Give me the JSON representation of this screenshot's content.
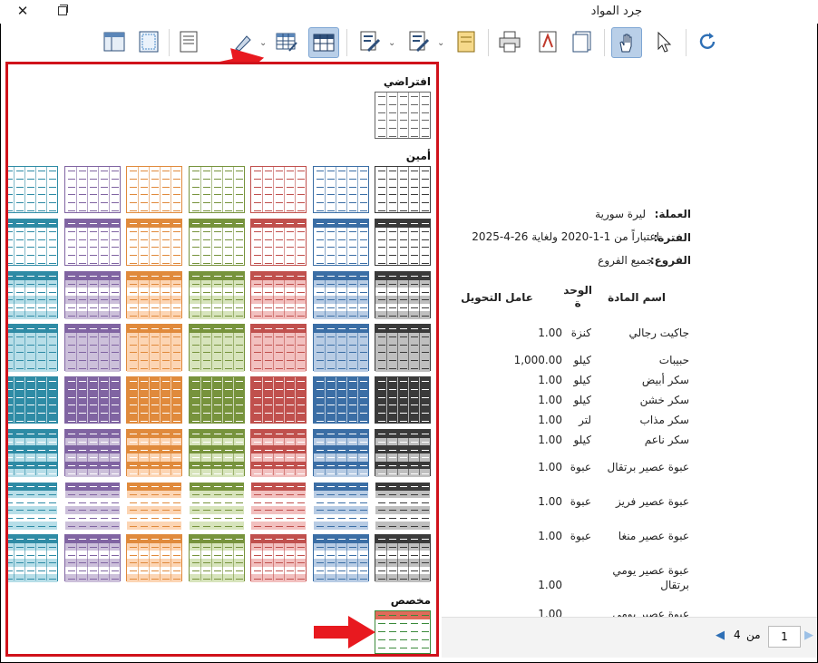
{
  "window": {
    "title": "جرد المواد",
    "close_glyph": "✕"
  },
  "toolbar": {
    "buttons": [
      "layout-icon",
      "page-frame-icon",
      "report-icon",
      "brush-icon",
      "table-style-icon",
      "grid-icon",
      "edit-page-icon",
      "edit-page2-icon",
      "document-icon",
      "print-icon",
      "pdf-icon",
      "copy-icon",
      "hand-icon",
      "pointer-icon",
      "refresh-icon"
    ],
    "active": [
      "grid-icon",
      "hand-icon"
    ]
  },
  "panel": {
    "sections": {
      "default": "افتراضي",
      "safe": "أمين",
      "custom": "مخصص"
    }
  },
  "report": {
    "currency_label": "العملة:",
    "currency_value": "ليرة سورية",
    "period_label": "الفترة:",
    "period_value": "اعتباراً من 1-1-2020 ولغاية 26-4-2025",
    "branches_label": "الفروع:",
    "branches_value": "جميع الفروع",
    "col_name": "اسم المادة",
    "col_unit": "الوحد\nة",
    "col_factor": "عامل التحويل",
    "rows": [
      {
        "name": "جاكيت رجالي",
        "unit": "كنزة",
        "factor": "1.00"
      },
      {
        "name": "حبيبات",
        "unit": "كيلو",
        "factor": "1,000.00"
      },
      {
        "name": "سكر أبيض",
        "unit": "كيلو",
        "factor": "1.00"
      },
      {
        "name": "سكر خشن",
        "unit": "كيلو",
        "factor": "1.00"
      },
      {
        "name": "سكر مذاب",
        "unit": "لتر",
        "factor": "1.00"
      },
      {
        "name": "سكر ناعم",
        "unit": "كيلو",
        "factor": "1.00"
      },
      {
        "name": "عبوة عصير برتقال",
        "unit": "عبوة",
        "factor": "1.00"
      },
      {
        "name": "عبوة عصير فريز",
        "unit": "عبوة",
        "factor": "1.00"
      },
      {
        "name": "عبوة عصير منغا",
        "unit": "عبوة",
        "factor": "1.00"
      },
      {
        "name": "عبوة عصير يومي",
        "name2": "برتقال",
        "unit": "",
        "factor": "1.00"
      },
      {
        "name": "عبوة عصير يومي",
        "unit": "",
        "factor": "1.00"
      }
    ]
  },
  "pager": {
    "current": "1",
    "of_label": "من",
    "total": "4"
  },
  "colors": {
    "highlight_red": "#d0121b",
    "palette": [
      "#2b2b2b",
      "#2b5a8c",
      "#3b7fb5",
      "#c0504d",
      "#7a9a3a",
      "#d07a2a",
      "#8a68b5",
      "#2e8b9a",
      "#7f7f7f",
      "#f08a8a"
    ]
  }
}
